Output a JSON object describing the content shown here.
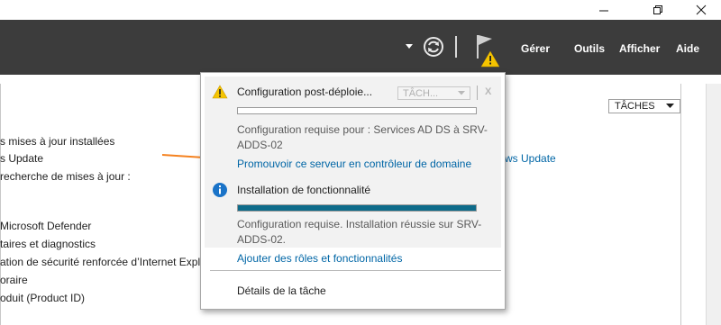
{
  "window": {
    "minimize_label": "—",
    "restore_label": "❐",
    "close_label": "✕"
  },
  "commandbar": {
    "menu": [
      "Gérer",
      "Outils",
      "Afficher",
      "Aide"
    ]
  },
  "background": {
    "lines": [
      "s mises à jour installées",
      "s Update",
      " recherche de mises à jour :",
      " Microsoft Defender",
      "taires et diagnostics",
      "ation de sécurité renforcée d’Internet Explo",
      "oraire",
      "oduit (Product ID)"
    ],
    "taches_label": "TÂCHES",
    "link_fragment": "ws Update"
  },
  "popup": {
    "notif1": {
      "title": "Configuration post-déploie...",
      "task_dropdown": "TÂCH...",
      "close_label": "X",
      "progress": 0,
      "message": "Configuration requise pour : Services AD DS à SRV-ADDS-02",
      "link": "Promouvoir ce serveur en contrôleur de domaine"
    },
    "notif2": {
      "title": "Installation de fonctionnalité",
      "progress": 1.0,
      "message": "Configuration requise. Installation réussie sur SRV-ADDS-02.",
      "link": "Ajouter des rôles et fonctionnalités"
    },
    "details_link": "Détails de la tâche"
  },
  "colors": {
    "commandbar_bg": "#3c3c3c",
    "link": "#0066a6",
    "progress_fill": "#0d6b8a",
    "warning": "#f5c400",
    "info": "#1a73c8",
    "arrow": "#f58220"
  }
}
